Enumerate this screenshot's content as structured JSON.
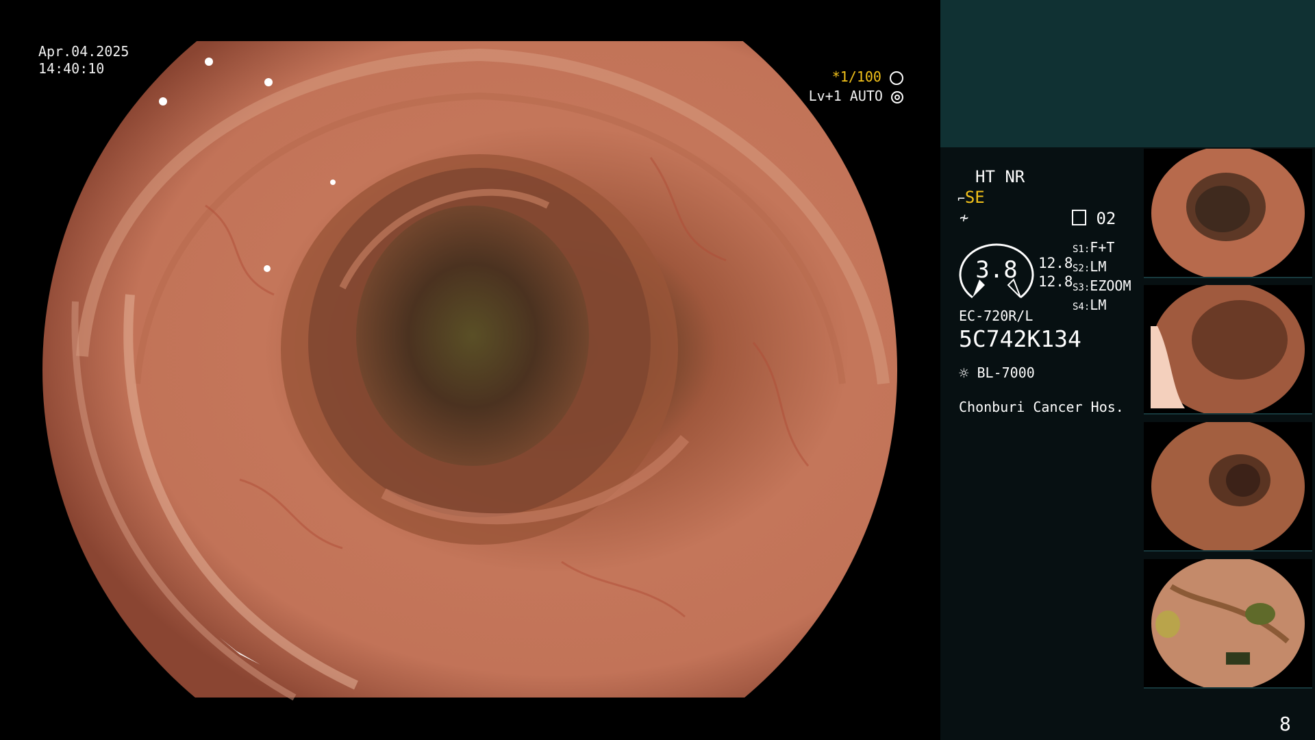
{
  "overlay": {
    "date": "Apr.04.2025",
    "time": "14:40:10",
    "shutter": "*1/100",
    "exposure": "Lv+1 AUTO"
  },
  "panel": {
    "ht_nr": "HT NR",
    "se": "SE",
    "memory_num": "02",
    "dial_value": "3.8",
    "value_a": "12.8",
    "value_b": "12.8",
    "switches": [
      {
        "key": "S1:",
        "val": "F+T"
      },
      {
        "key": "S2:",
        "val": "LM"
      },
      {
        "key": "S3:",
        "val": "EZOOM"
      },
      {
        "key": "S4:",
        "val": "LM"
      }
    ],
    "scope_model": "EC-720R/L",
    "scope_serial": "5C742K134",
    "light_source": "BL-7000",
    "hospital": "Chonburi Cancer Hos.",
    "page_number": "8"
  },
  "colors": {
    "panel_top": "#103133",
    "panel_bg": "#071012",
    "accent_yellow": "#f3c21a"
  },
  "icons": [
    "aperture-icon",
    "iris-icon",
    "scope-icon",
    "signal-icon",
    "memory-icon",
    "lamp-icon"
  ]
}
